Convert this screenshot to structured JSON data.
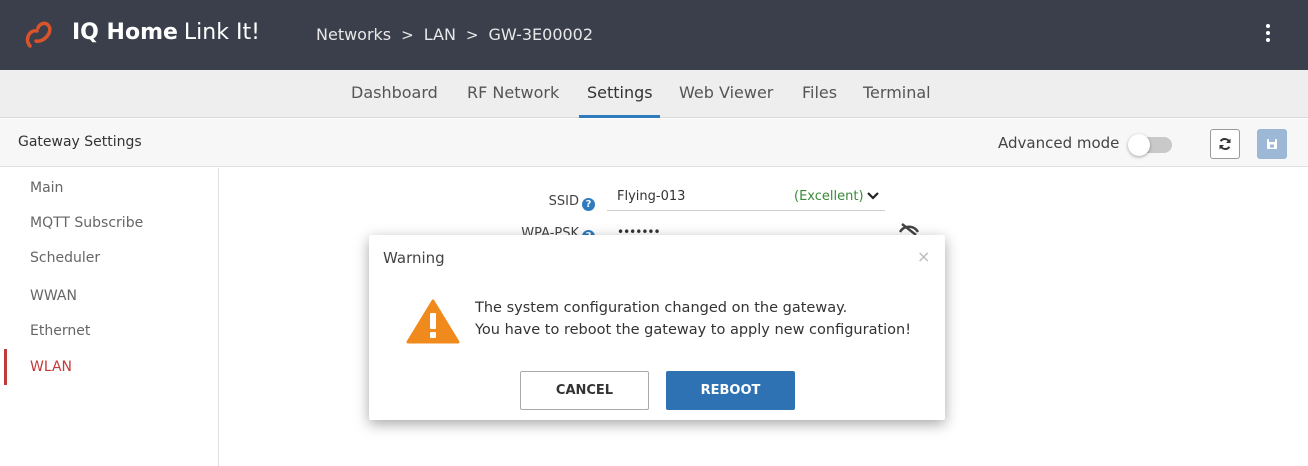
{
  "app": {
    "brand_bold": "IQ Home",
    "brand_rest": "Link It!",
    "breadcrumbs": [
      "Networks",
      "LAN",
      "GW-3E00002"
    ],
    "breadcrumb_separator": ">"
  },
  "tabs": [
    {
      "label": "Dashboard",
      "active": false
    },
    {
      "label": "RF Network",
      "active": false
    },
    {
      "label": "Settings",
      "active": true
    },
    {
      "label": "Web Viewer",
      "active": false
    },
    {
      "label": "Files",
      "active": false
    },
    {
      "label": "Terminal",
      "active": false
    }
  ],
  "header": {
    "title": "Gateway Settings",
    "advanced_mode_label": "Advanced mode",
    "advanced_mode_on": false
  },
  "sidebar": {
    "items": [
      {
        "label": "Main",
        "active": false
      },
      {
        "label": "MQTT Subscribe",
        "active": false
      },
      {
        "label": "Scheduler",
        "active": false
      },
      {
        "label": "WWAN",
        "active": false
      },
      {
        "label": "Ethernet",
        "active": false
      },
      {
        "label": "WLAN",
        "active": true
      }
    ]
  },
  "form": {
    "ssid_label": "SSID",
    "ssid_value": "Flying-013",
    "ssid_quality": "(Excellent)",
    "wpa_label": "WPA-PSK",
    "wpa_value": "•••••••"
  },
  "dialog": {
    "title": "Warning",
    "close": "×",
    "message_line1": "The system configuration changed on the gateway.",
    "message_line2": "You have to reboot the gateway to apply new configuration!",
    "cancel_label": "CANCEL",
    "reboot_label": "REBOOT"
  },
  "colors": {
    "topbar": "#3a3f4b",
    "accent": "#2e7bbf",
    "active_sidebar": "#c23a3a",
    "warning": "#f08a1c",
    "success": "#3a8a3a"
  }
}
